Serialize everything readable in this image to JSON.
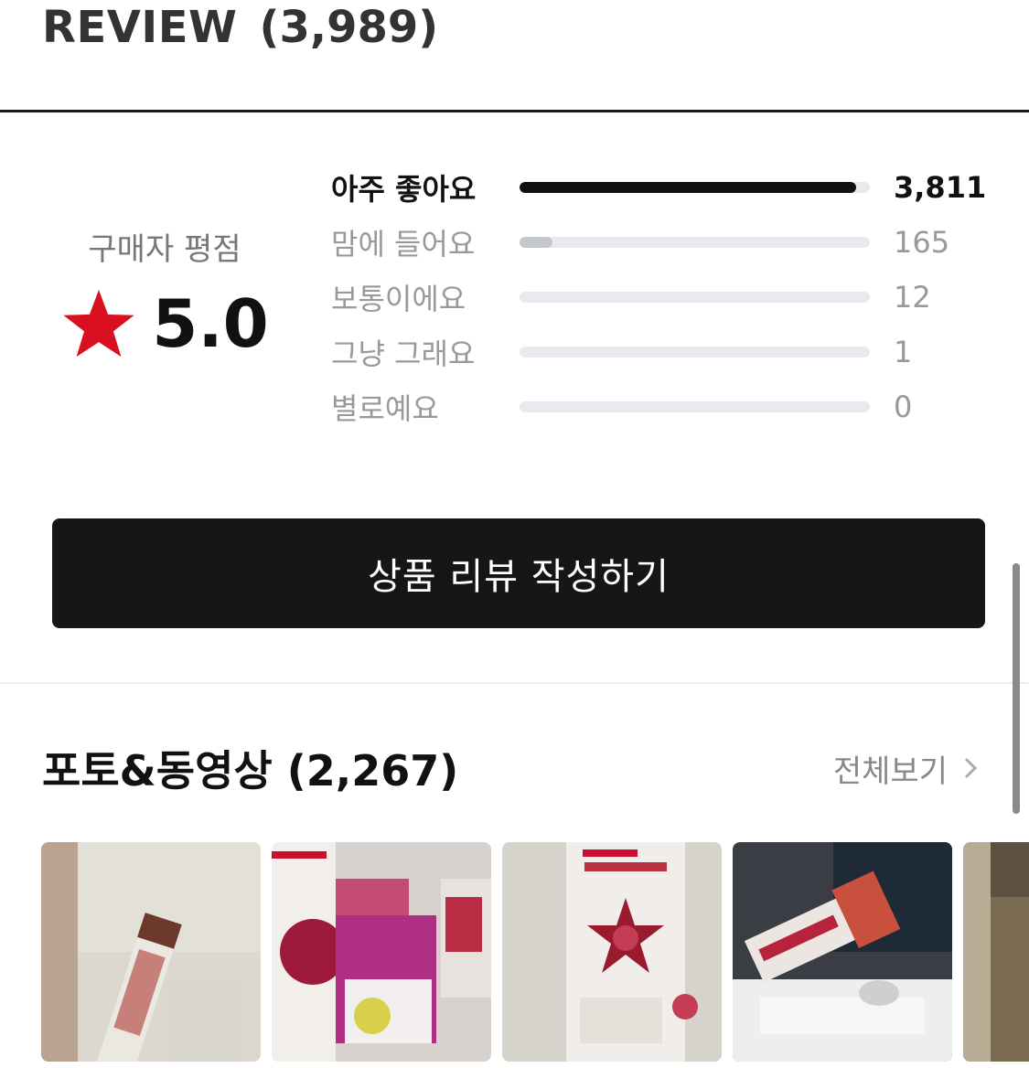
{
  "header": {
    "title": "REVIEW",
    "count": "(3,989)"
  },
  "summary": {
    "label": "구매자 평점",
    "score": "5.0",
    "star_color": "#d9101f"
  },
  "distribution": [
    {
      "label": "아주 좋아요",
      "count": "3,811",
      "share": 0.96
    },
    {
      "label": "맘에 들어요",
      "count": "165",
      "share": 0.095
    },
    {
      "label": "보통이에요",
      "count": "12",
      "share": 0
    },
    {
      "label": "그냥 그래요",
      "count": "1",
      "share": 0
    },
    {
      "label": "별로예요",
      "count": "0",
      "share": 0
    }
  ],
  "write_button": {
    "label": "상품 리뷰 작성하기"
  },
  "photos": {
    "title": "포토&동영상 (2,267)",
    "view_all": "전체보기"
  },
  "colors": {
    "accent_dark": "#161618",
    "star": "#d9101f",
    "bar_track": "#e8eaef",
    "bar_fill_top": "#111111",
    "bar_fill_other": "#c4c7cd"
  }
}
